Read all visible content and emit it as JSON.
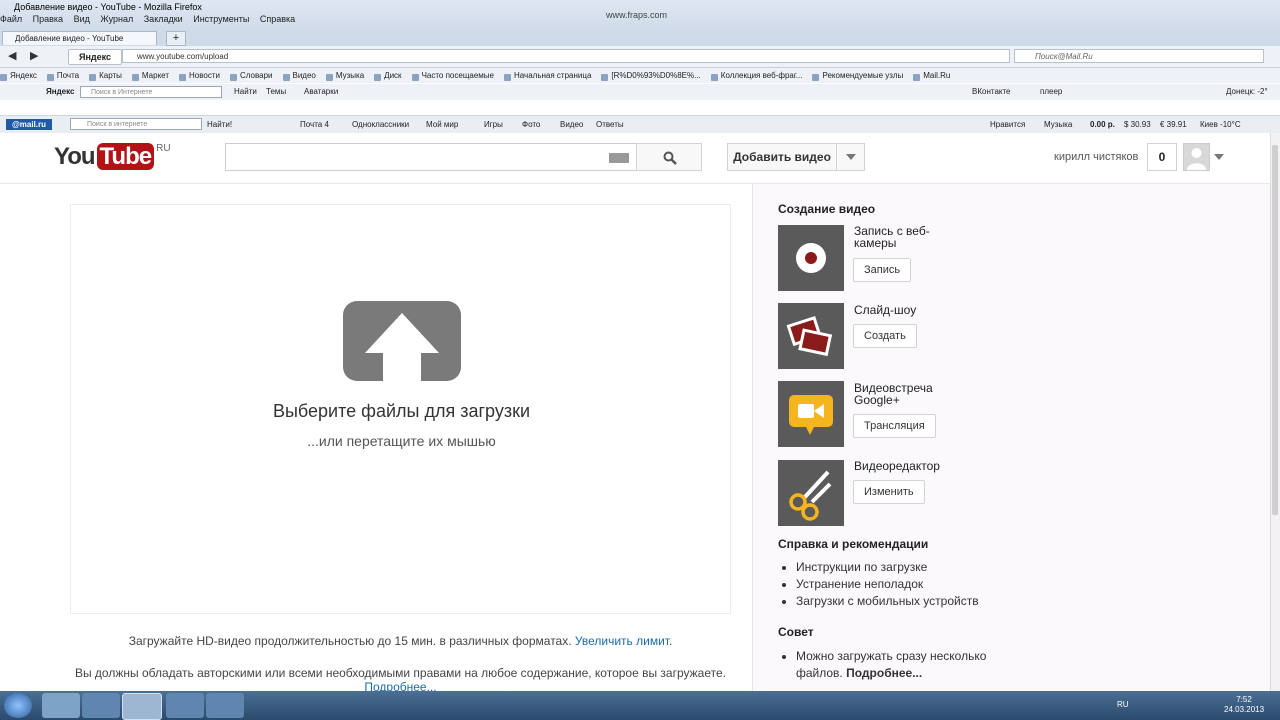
{
  "window": {
    "title": "Добавление видео - YouTube - Mozilla Firefox",
    "watermark": "www.fraps.com"
  },
  "menu": [
    "Файл",
    "Правка",
    "Вид",
    "Журнал",
    "Закладки",
    "Инструменты",
    "Справка"
  ],
  "tab": {
    "title": "Добавление видео - YouTube"
  },
  "nav": {
    "yandex_label": "Яндекс",
    "url": "www.youtube.com/upload",
    "search_placeholder": "Поиск@Mail.Ru"
  },
  "bookmarks": [
    "Яндекс",
    "Почта",
    "Карты",
    "Маркет",
    "Новости",
    "Словари",
    "Видео",
    "Музыка",
    "Диск",
    "Часто посещаемые",
    "Начальная страница",
    "[R%D0%93%D0%8E%...",
    "Коллекция веб-фраг...",
    "Рекомендуемые узлы",
    "Mail.Ru"
  ],
  "yandex_bar": {
    "label": "Яндекс",
    "placeholder": "Поиск в Интернете",
    "find": "Найти",
    "themes": "Темы",
    "avatars": "Аватарки",
    "right_items": [
      "ВКонтакте",
      "плеер",
      "Донецк: -2°"
    ]
  },
  "mailru_bar": {
    "logo": "@mail.ru",
    "placeholder": "Поиск в интернете",
    "find": "Найти!",
    "items": [
      "Почта 4",
      "Одноклассники",
      "Мой мир",
      "Игры",
      "Фото",
      "Видео",
      "Ответы"
    ],
    "right_items": [
      "Нравится",
      "Музыка",
      "0.00 р.",
      "$ 30.93",
      "€ 39.91",
      "Киев -10°C"
    ]
  },
  "header": {
    "logo_you": "You",
    "logo_tube": "Tube",
    "logo_region": "RU",
    "search_value": "",
    "upload_button": "Добавить видео",
    "username": "кирилл чистяков",
    "notifications": "0"
  },
  "upload": {
    "title": "Выберите файлы для загрузки",
    "subtitle": "...или перетащите их мышью",
    "hd_note": "Загружайте HD-видео продолжительностью до 15 мин. в различных форматах.",
    "hd_link": "Увеличить лимит",
    "rights_note": "Вы должны обладать авторскими или всеми необходимыми правами на любое содержание, которое вы загружаете.",
    "rights_link": "Подробнее..."
  },
  "sidebar": {
    "create_title": "Создание видео",
    "options": [
      {
        "label": "Запись с веб-камеры",
        "button": "Запись",
        "icon": "webcam-record-icon"
      },
      {
        "label": "Слайд-шоу",
        "button": "Создать",
        "icon": "slideshow-icon"
      },
      {
        "label": "Видеовстреча Google+",
        "button": "Трансляция",
        "icon": "hangout-icon"
      },
      {
        "label": "Видеоредактор",
        "button": "Изменить",
        "icon": "scissors-icon"
      }
    ],
    "help_title": "Справка и рекомендации",
    "help_links": [
      "Инструкции по загрузке",
      "Устранение неполадок",
      "Загрузки с мобильных устройств"
    ],
    "tip_title": "Совет",
    "tip_text": "Можно загружать сразу несколько файлов.",
    "tip_link": "Подробнее..."
  },
  "taskbar": {
    "lang": "RU",
    "time": "7:52",
    "date": "24.03.2013"
  },
  "colors": {
    "youtube_red": "#b31217",
    "link_blue": "#1a6ca8",
    "hangout_yellow": "#f6b51e",
    "tile_gray": "#5a5a5a"
  }
}
